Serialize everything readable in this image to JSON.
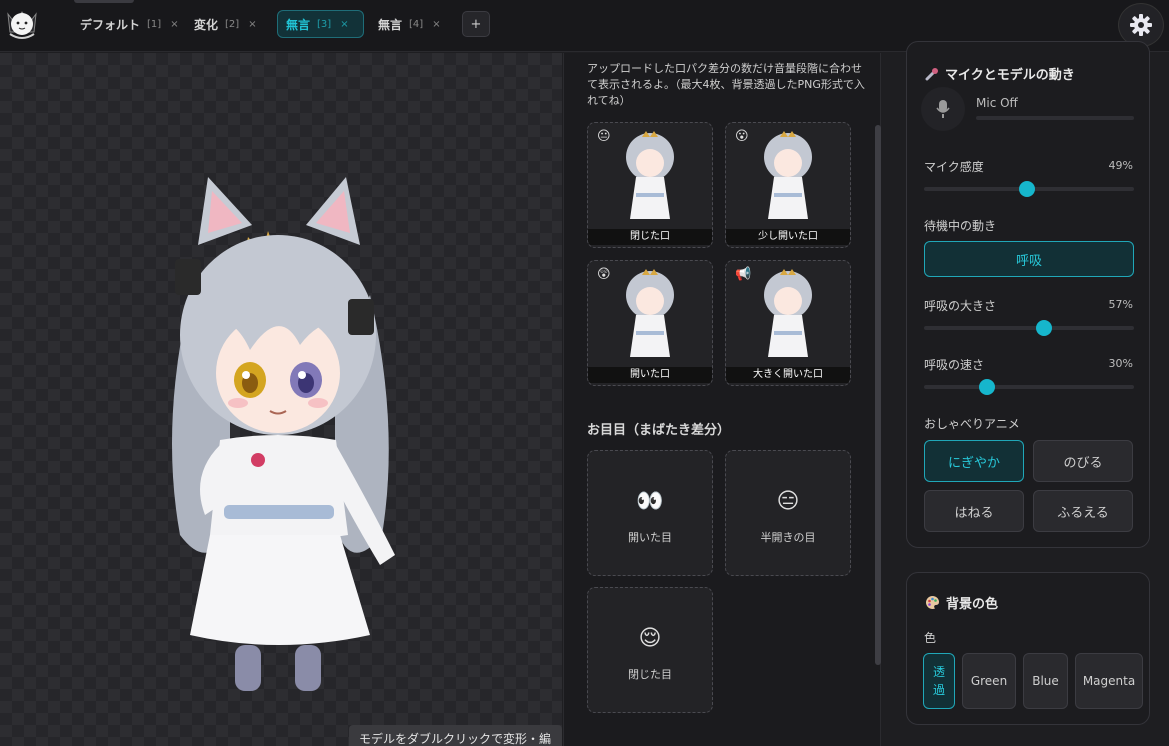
{
  "tabs": [
    {
      "name": "デフォルト",
      "num": "[1]",
      "close": "×",
      "active": false
    },
    {
      "name": "変化",
      "num": "[2]",
      "close": "×",
      "active": false
    },
    {
      "name": "無言",
      "num": "[3]",
      "close": "×",
      "active": true
    },
    {
      "name": "無言",
      "num": "[4]",
      "close": "×",
      "active": false
    }
  ],
  "add_tab_label": "+",
  "canvas": {
    "hint": "モデルをダブルクリックで変形・編集"
  },
  "mouth": {
    "description": "アップロードした口パク差分の数だけ音量段階に合わせて表示されるよ。（最大4枚、背景透過したPNG形式で入れてね）",
    "cards": [
      {
        "emoji": "😐",
        "label": "閉じた口"
      },
      {
        "emoji": "😮",
        "label": "少し開いた口"
      },
      {
        "emoji": "😲",
        "label": "開いた口"
      },
      {
        "emoji": "📢",
        "label": "大きく開いた口"
      }
    ]
  },
  "eyes": {
    "title": "お目目（まばたき差分）",
    "cards": [
      {
        "icon": "👀",
        "label": "開いた目"
      },
      {
        "icon": "😑",
        "label": "半開きの目"
      },
      {
        "icon": "😌",
        "label": "閉じた目"
      }
    ]
  },
  "mic_panel": {
    "title": "マイクとモデルの動き",
    "mic_status": "Mic Off",
    "sensitivity": {
      "label": "マイク感度",
      "value_text": "49%",
      "value": 0.49
    },
    "idle": {
      "label": "待機中の動き",
      "option": "呼吸"
    },
    "breath_size": {
      "label": "呼吸の大きさ",
      "value_text": "57%",
      "value": 0.57
    },
    "breath_speed": {
      "label": "呼吸の速さ",
      "value_text": "30%",
      "value": 0.3
    },
    "talk_anim": {
      "label": "おしゃべりアニメ",
      "options": [
        "にぎやか",
        "のびる",
        "はねる",
        "ふるえる"
      ],
      "selected": "にぎやか"
    }
  },
  "bg_panel": {
    "title": "背景の色",
    "color_label": "色",
    "options": [
      "透過",
      "Green",
      "Blue",
      "Magenta"
    ],
    "selected": "透過"
  },
  "colors": {
    "accent": "#16b6cc",
    "bg": "#1e1e21",
    "panel": "#1c1c1f"
  }
}
